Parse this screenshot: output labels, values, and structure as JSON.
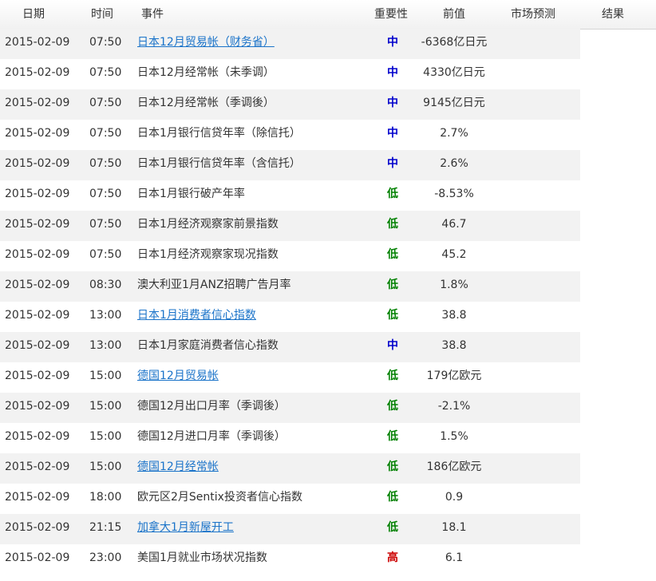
{
  "header": {
    "date": "日期",
    "time": "时间",
    "event": "事件",
    "importance": "重要性",
    "previous": "前值",
    "forecast": "市场预测",
    "result": "结果"
  },
  "colors": {
    "mid": "#0000cc",
    "low": "#008000",
    "high": "#cc0000",
    "link": "#1a73c9"
  },
  "rows": [
    {
      "date": "2015-02-09",
      "time": "07:50",
      "event": "日本12月贸易帐（财务省）",
      "link": true,
      "importance": "中",
      "level": "mid",
      "previous": "-6368亿日元"
    },
    {
      "date": "2015-02-09",
      "time": "07:50",
      "event": "日本12月经常帐（未季调）",
      "link": false,
      "importance": "中",
      "level": "mid",
      "previous": "4330亿日元"
    },
    {
      "date": "2015-02-09",
      "time": "07:50",
      "event": "日本12月经常帐（季调後）",
      "link": false,
      "importance": "中",
      "level": "mid",
      "previous": "9145亿日元"
    },
    {
      "date": "2015-02-09",
      "time": "07:50",
      "event": "日本1月银行信贷年率（除信托）",
      "link": false,
      "importance": "中",
      "level": "mid",
      "previous": "2.7%"
    },
    {
      "date": "2015-02-09",
      "time": "07:50",
      "event": "日本1月银行信贷年率（含信托）",
      "link": false,
      "importance": "中",
      "level": "mid",
      "previous": "2.6%"
    },
    {
      "date": "2015-02-09",
      "time": "07:50",
      "event": "日本1月银行破产年率",
      "link": false,
      "importance": "低",
      "level": "low",
      "previous": "-8.53%"
    },
    {
      "date": "2015-02-09",
      "time": "07:50",
      "event": "日本1月经济观察家前景指数",
      "link": false,
      "importance": "低",
      "level": "low",
      "previous": "46.7"
    },
    {
      "date": "2015-02-09",
      "time": "07:50",
      "event": "日本1月经济观察家现况指数",
      "link": false,
      "importance": "低",
      "level": "low",
      "previous": "45.2"
    },
    {
      "date": "2015-02-09",
      "time": "08:30",
      "event": "澳大利亚1月ANZ招聘广告月率",
      "link": false,
      "importance": "低",
      "level": "low",
      "previous": "1.8%"
    },
    {
      "date": "2015-02-09",
      "time": "13:00",
      "event": "日本1月消费者信心指数",
      "link": true,
      "importance": "低",
      "level": "low",
      "previous": "38.8"
    },
    {
      "date": "2015-02-09",
      "time": "13:00",
      "event": "日本1月家庭消费者信心指数",
      "link": false,
      "importance": "中",
      "level": "mid",
      "previous": "38.8"
    },
    {
      "date": "2015-02-09",
      "time": "15:00",
      "event": "德国12月贸易帐",
      "link": true,
      "importance": "低",
      "level": "low",
      "previous": "179亿欧元"
    },
    {
      "date": "2015-02-09",
      "time": "15:00",
      "event": "德国12月出口月率（季调後）",
      "link": false,
      "importance": "低",
      "level": "low",
      "previous": "-2.1%"
    },
    {
      "date": "2015-02-09",
      "time": "15:00",
      "event": "德国12月进口月率（季调後）",
      "link": false,
      "importance": "低",
      "level": "low",
      "previous": "1.5%"
    },
    {
      "date": "2015-02-09",
      "time": "15:00",
      "event": "德国12月经常帐",
      "link": true,
      "importance": "低",
      "level": "low",
      "previous": "186亿欧元"
    },
    {
      "date": "2015-02-09",
      "time": "18:00",
      "event": "欧元区2月Sentix投资者信心指数",
      "link": false,
      "importance": "低",
      "level": "low",
      "previous": "0.9"
    },
    {
      "date": "2015-02-09",
      "time": "21:15",
      "event": "加拿大1月新屋开工",
      "link": true,
      "importance": "低",
      "level": "low",
      "previous": "18.1"
    },
    {
      "date": "2015-02-09",
      "time": "23:00",
      "event": "美国1月就业市场状况指数",
      "link": false,
      "importance": "高",
      "level": "high",
      "previous": "6.1"
    }
  ]
}
